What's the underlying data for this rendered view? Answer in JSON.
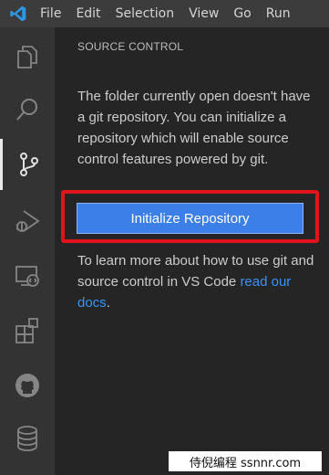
{
  "titlebar": {
    "menu": [
      "File",
      "Edit",
      "Selection",
      "View",
      "Go",
      "Run"
    ]
  },
  "activitybar": {
    "items": [
      {
        "icon": "explorer-icon",
        "active": false
      },
      {
        "icon": "search-icon",
        "active": false
      },
      {
        "icon": "source-control-icon",
        "active": true
      },
      {
        "icon": "run-debug-icon",
        "active": false
      },
      {
        "icon": "remote-explorer-icon",
        "active": false
      },
      {
        "icon": "extensions-icon",
        "active": false
      },
      {
        "icon": "github-icon",
        "active": false
      },
      {
        "icon": "database-icon",
        "active": false
      }
    ]
  },
  "sidebar": {
    "title": "SOURCE CONTROL",
    "message": "The folder currently open doesn't have a git repository. You can initialize a repository which will enable source control features powered by git.",
    "button_label": "Initialize Repository",
    "learn_more": "To learn more about how to use git and source control in VS Code",
    "link_text": "read our docs",
    "link_suffix": "."
  },
  "watermark": {
    "text": "侍倪编程 ssnnr.com"
  },
  "colors": {
    "accent": "#3d7fe8",
    "highlight": "#e0141b",
    "link": "#3794ff"
  }
}
